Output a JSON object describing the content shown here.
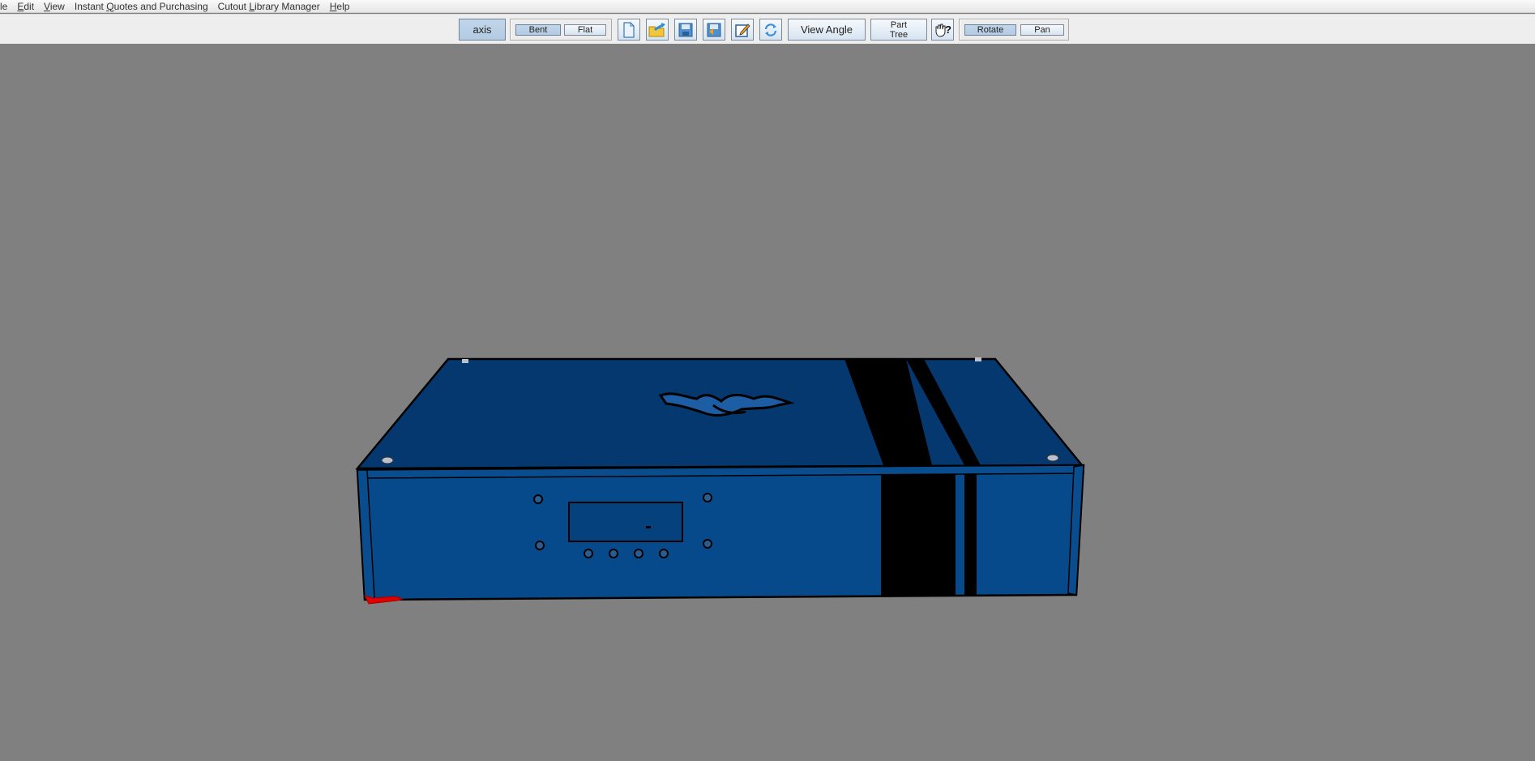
{
  "menubar": {
    "items": [
      {
        "label": "le",
        "mnemonic": ""
      },
      {
        "label": "Edit",
        "mnemonic": "E"
      },
      {
        "label": "View",
        "mnemonic": "V"
      },
      {
        "label": "Instant Quotes and Purchasing",
        "mnemonic": "Q"
      },
      {
        "label": "Cutout Library Manager",
        "mnemonic": "L"
      },
      {
        "label": "Help",
        "mnemonic": "H"
      }
    ]
  },
  "toolbar": {
    "axis_label": "axis",
    "axis_selected": true,
    "bent_label": "Bent",
    "bent_selected": true,
    "flat_label": "Flat",
    "icons": [
      {
        "name": "new-document-icon",
        "tooltip": "New"
      },
      {
        "name": "open-folder-icon",
        "tooltip": "Open"
      },
      {
        "name": "save-icon",
        "tooltip": "Save"
      },
      {
        "name": "save-as-icon",
        "tooltip": "Save As"
      },
      {
        "name": "edit-icon",
        "tooltip": "Edit"
      },
      {
        "name": "refresh-icon",
        "tooltip": "Refresh"
      }
    ],
    "view_angle_label": "View Angle",
    "part_tree_line1": "Part",
    "part_tree_line2": "Tree",
    "help_cursor_icon": "hand-question-icon",
    "rotate_label": "Rotate",
    "rotate_selected": true,
    "pan_label": "Pan"
  },
  "viewport": {
    "background": "#808080",
    "model": {
      "description": "Blue sheet-metal enclosure with black racing stripes",
      "body_color": "#064a8c",
      "top_color": "#04386e",
      "stripe_color": "#000000",
      "axis_indicator_color": "#e00000"
    }
  }
}
